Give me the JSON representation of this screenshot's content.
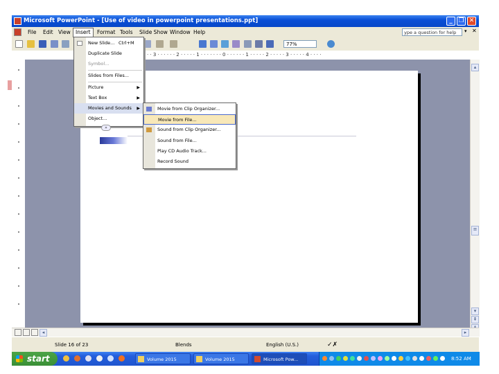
{
  "window": {
    "title": "Microsoft PowerPoint - [Use of video in powerpoint presentations.ppt]"
  },
  "menubar": {
    "items": [
      "File",
      "Edit",
      "View",
      "Insert",
      "Format",
      "Tools",
      "Slide Show",
      "Window",
      "Help"
    ],
    "help_placeholder": "ype a question for help"
  },
  "toolbar": {
    "zoom": "77%"
  },
  "ruler": {
    "text": "· · 3 · · · ·   · · 2 · · · · · 1 · · · · · · · 0 · · · · · · 1 · · · · · 2 · · · · · 3 · · · · · 4 · · · ·"
  },
  "insert_menu": {
    "items": [
      {
        "label": "New Slide...",
        "shortcut": "Ctrl+M"
      },
      {
        "label": "Duplicate Slide"
      },
      {
        "label": "Symbol..."
      },
      {
        "label": "Slides from Files..."
      },
      {
        "label": "Picture",
        "submenu": true
      },
      {
        "label": "Text Box",
        "submenu": true
      },
      {
        "label": "Movies and Sounds",
        "submenu": true,
        "highlighted": true
      },
      {
        "label": "Object..."
      }
    ],
    "expand_glyph": "»"
  },
  "movies_submenu": {
    "items": [
      {
        "label": "Movie from Clip Organizer..."
      },
      {
        "label": "Movie from File...",
        "highlighted": true
      },
      {
        "label": "Sound from Clip Organizer..."
      },
      {
        "label": "Sound from File..."
      },
      {
        "label": "Play CD Audio Track..."
      },
      {
        "label": "Record Sound"
      }
    ]
  },
  "statusbar": {
    "slide": "Slide 16 of 23",
    "design": "Blends",
    "language": "English (U.S.)"
  },
  "taskbar": {
    "start": "start",
    "tasks": [
      "Volume 2015",
      "Volume 2015",
      "Microsoft Pow..."
    ],
    "clock": "8:52 AM"
  },
  "colors": {
    "title_bar": "#0a4fd6",
    "workspace": "#8d93ab",
    "taskbar": "#245edb",
    "start": "#3a8f36",
    "menu_highlight": "#f8e8b8"
  }
}
